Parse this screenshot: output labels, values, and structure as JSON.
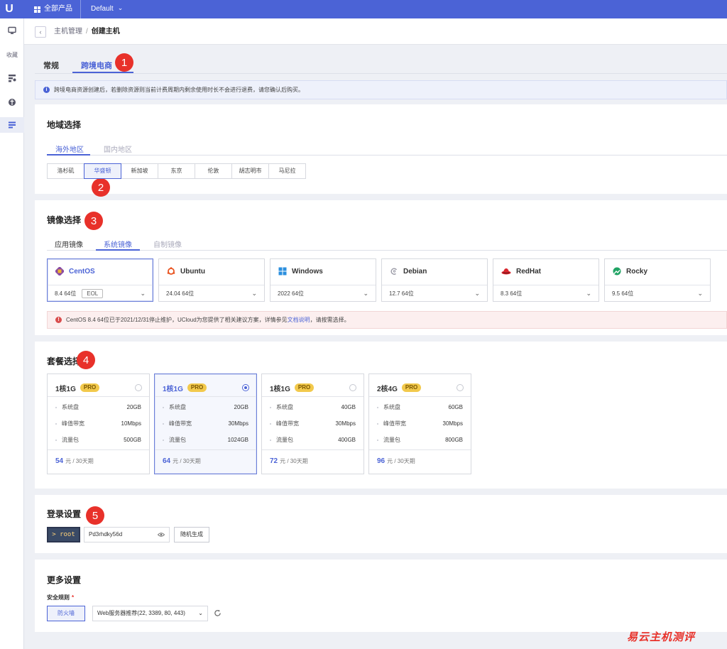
{
  "topbar": {
    "logo": "U",
    "products_label": "全部产品",
    "project": "Default",
    "project_chevron": "⌄"
  },
  "sidebar": {
    "favorites_label": "收藏"
  },
  "breadcrumb": {
    "back_glyph": "‹",
    "parent": "主机管理",
    "separator": "/",
    "current": "创建主机"
  },
  "tabs": [
    {
      "label": "常规"
    },
    {
      "label": "跨境电商"
    }
  ],
  "badges": [
    "1",
    "2",
    "3",
    "4",
    "5"
  ],
  "notice": {
    "icon": "i",
    "text": "跨境电商资源创建后，若删除资源则当前计费周期内剩余使用时长不会进行退费，请您确认后购买。"
  },
  "region": {
    "title": "地域选择",
    "subtabs": [
      {
        "label": "海外地区"
      },
      {
        "label": "国内地区"
      }
    ],
    "cities": [
      "洛杉矶",
      "华盛顿",
      "新加坡",
      "东京",
      "伦敦",
      "胡志明市",
      "马尼拉"
    ],
    "selected_index": 1
  },
  "image": {
    "title": "镜像选择",
    "subtabs": [
      {
        "label": "应用镜像"
      },
      {
        "label": "系统镜像"
      },
      {
        "label": "自制镜像"
      }
    ],
    "items": [
      {
        "name": "CentOS",
        "version": "8.4 64位",
        "tag": "EOL",
        "icon": "centos-icon",
        "color": "#8a4ba3"
      },
      {
        "name": "Ubuntu",
        "version": "24.04 64位",
        "icon": "ubuntu-icon",
        "color": "#e95420"
      },
      {
        "name": "Windows",
        "version": "2022 64位",
        "icon": "windows-icon",
        "color": "#2b8fde"
      },
      {
        "name": "Debian",
        "version": "12.7 64位",
        "icon": "debian-icon",
        "color": "#9a9aa6"
      },
      {
        "name": "RedHat",
        "version": "8.3 64位",
        "icon": "redhat-icon",
        "color": "#d8262d"
      },
      {
        "name": "Rocky",
        "version": "9.5 64位",
        "icon": "rocky-icon",
        "color": "#20a364"
      }
    ],
    "warning": {
      "icon": "!",
      "text": "CentOS 8.4 64位已于2021/12/31停止维护，UCloud为您提供了相关建议方案，详情参见",
      "link": "文档说明",
      "suffix": "，请按需选择。"
    }
  },
  "package": {
    "title": "套餐选择",
    "pro_label": "PRO",
    "spec_labels": [
      "系统盘",
      "峰值带宽",
      "流量包"
    ],
    "price_unit": "元 / 30天期",
    "items": [
      {
        "name": "1核1G",
        "disk": "20GB",
        "bandwidth": "10Mbps",
        "traffic": "500GB",
        "price": "54",
        "selected": false
      },
      {
        "name": "1核1G",
        "disk": "20GB",
        "bandwidth": "30Mbps",
        "traffic": "1024GB",
        "price": "64",
        "selected": true
      },
      {
        "name": "1核1G",
        "disk": "40GB",
        "bandwidth": "30Mbps",
        "traffic": "400GB",
        "price": "72",
        "selected": false
      },
      {
        "name": "2核4G",
        "disk": "60GB",
        "bandwidth": "30Mbps",
        "traffic": "800GB",
        "price": "96",
        "selected": false
      }
    ]
  },
  "login": {
    "title": "登录设置",
    "user": "> root",
    "password": "Pd3rhdky56d",
    "generate_label": "随机生成"
  },
  "more": {
    "title": "更多设置",
    "rule_label": "安全规则",
    "required_mark": "*",
    "firewall_label": "防火墙",
    "rule_value": "Web服务器推荐(22, 3389, 80, 443)",
    "rule_chevron": "⌄"
  },
  "watermark": "易云主机测评",
  "colors": {
    "accent": "#4b63d6",
    "badge": "#e8312a",
    "pro": "#f2c94c"
  }
}
